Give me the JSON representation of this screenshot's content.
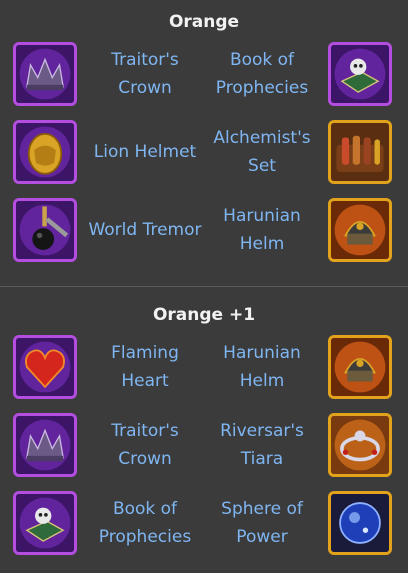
{
  "sections": [
    {
      "title": "Orange",
      "rows": [
        {
          "left": {
            "name": "Traitor's\nCrown",
            "icon": "traitors-crown-icon"
          },
          "right": {
            "name": "Book of\nProphecies",
            "icon": "book-of-prophecies-icon"
          }
        },
        {
          "left": {
            "name": "Lion Helmet",
            "icon": "lion-helmet-icon"
          },
          "right": {
            "name": "Alchemist's\nSet",
            "icon": "alchemists-set-icon"
          }
        },
        {
          "left": {
            "name": "World Tremor",
            "icon": "world-tremor-icon"
          },
          "right": {
            "name": "Harunian\nHelm",
            "icon": "harunian-helm-icon"
          }
        }
      ]
    },
    {
      "title": "Orange +1",
      "rows": [
        {
          "left": {
            "name": "Flaming\nHeart",
            "icon": "flaming-heart-icon"
          },
          "right": {
            "name": "Harunian\nHelm",
            "icon": "harunian-helm-icon"
          }
        },
        {
          "left": {
            "name": "Traitor's\nCrown",
            "icon": "traitors-crown-icon"
          },
          "right": {
            "name": "Riversar's\nTiara",
            "icon": "riversars-tiara-icon"
          }
        },
        {
          "left": {
            "name": "Book of\nProphecies",
            "icon": "book-of-prophecies-icon"
          },
          "right": {
            "name": "Sphere of\nPower",
            "icon": "sphere-of-power-icon"
          }
        }
      ]
    }
  ],
  "colors": {
    "background": "#3b3b3b",
    "item_text": "#7fb6f2",
    "title_text": "#f2f2f2",
    "frame_purple": "#b44ee0",
    "frame_gold": "#e3a21b"
  }
}
